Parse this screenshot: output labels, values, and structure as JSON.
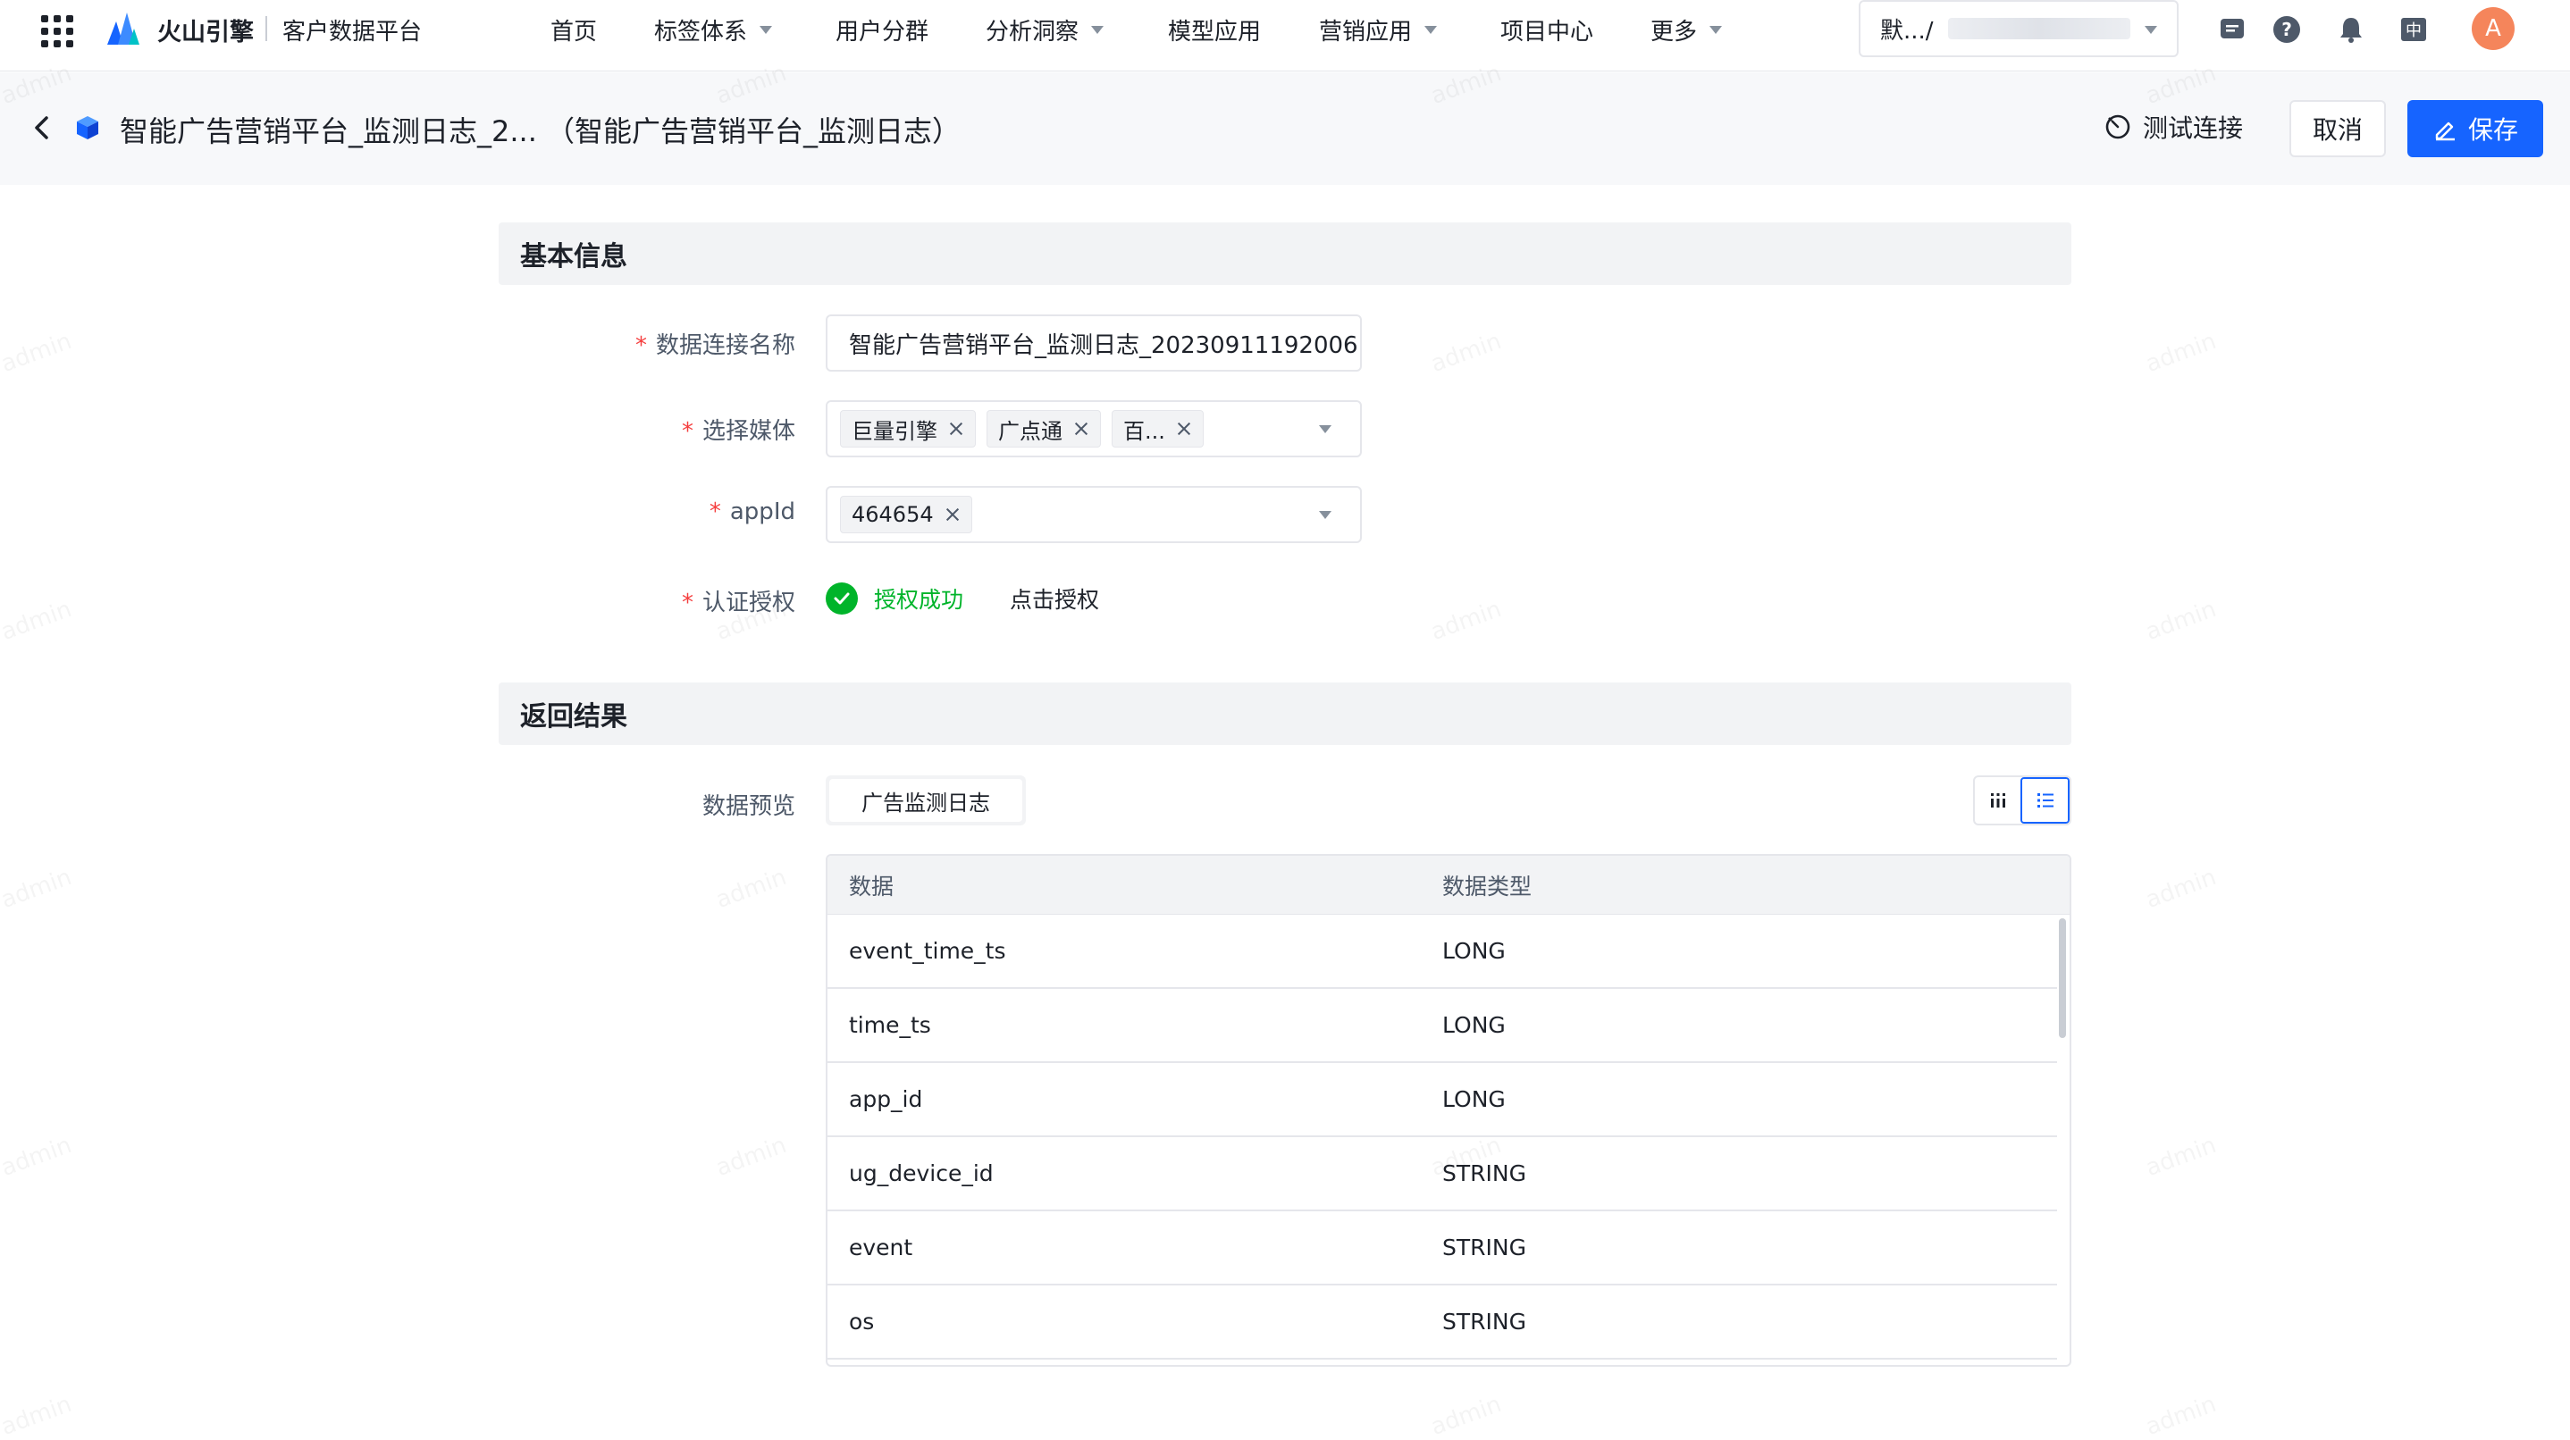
{
  "topnav": {
    "brand": "火山引擎",
    "product": "客户数据平台",
    "items": [
      {
        "label": "首页",
        "has_dropdown": false
      },
      {
        "label": "标签体系",
        "has_dropdown": true
      },
      {
        "label": "用户分群",
        "has_dropdown": false
      },
      {
        "label": "分析洞察",
        "has_dropdown": true
      },
      {
        "label": "模型应用",
        "has_dropdown": false
      },
      {
        "label": "营销应用",
        "has_dropdown": true
      },
      {
        "label": "项目中心",
        "has_dropdown": false
      },
      {
        "label": "更多",
        "has_dropdown": true
      }
    ],
    "project_selector": "默.../",
    "icons": [
      "message-icon",
      "help-icon",
      "bell-icon",
      "language-icon"
    ],
    "language_label": "中",
    "avatar_letter": "A"
  },
  "header": {
    "title": "智能广告营销平台_监测日志_2...  （智能广告营销平台_监测日志）",
    "test_connection_label": "测试连接",
    "cancel_label": "取消",
    "save_label": "保存"
  },
  "basic_info": {
    "section_title": "基本信息",
    "connection_name_label": "数据连接名称",
    "connection_name_value": "智能广告营销平台_监测日志_20230911192006",
    "media_label": "选择媒体",
    "media_tags": [
      "巨量引擎",
      "广点通",
      "百..."
    ],
    "appid_label": "appId",
    "appid_tags": [
      "464654"
    ],
    "auth_label": "认证授权",
    "auth_status": "授权成功",
    "auth_action": "点击授权"
  },
  "result": {
    "section_title": "返回结果",
    "preview_label": "数据预览",
    "preview_tab": "广告监测日志",
    "columns": [
      "数据",
      "数据类型"
    ],
    "rows": [
      {
        "name": "event_time_ts",
        "type": "LONG"
      },
      {
        "name": "time_ts",
        "type": "LONG"
      },
      {
        "name": "app_id",
        "type": "LONG"
      },
      {
        "name": "ug_device_id",
        "type": "STRING"
      },
      {
        "name": "event",
        "type": "STRING"
      },
      {
        "name": "os",
        "type": "STRING"
      }
    ]
  },
  "watermark_text": "admin",
  "colors": {
    "primary": "#1664ff",
    "success": "#00b42a",
    "required": "#f53f3f",
    "avatar": "#f5855b"
  }
}
